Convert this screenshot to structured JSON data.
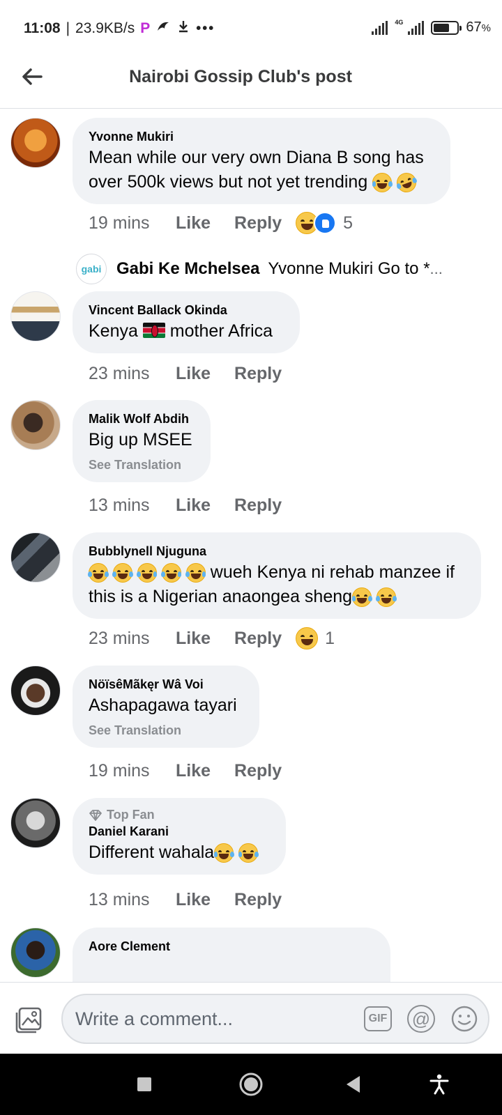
{
  "status_bar": {
    "time": "11:08",
    "speed": "23.9KB/s",
    "network": "4G",
    "battery": "67",
    "battery_unit": "%",
    "battery_level": 0.67
  },
  "header": {
    "title": "Nairobi Gossip Club's post"
  },
  "actions": {
    "like": "Like",
    "reply": "Reply"
  },
  "comments": [
    {
      "author": "Yvonne Mukiri",
      "text": "Mean while our very own Diana B song has over 500k views but not yet trending",
      "time": "19 mins",
      "reaction_count": "5",
      "reply": {
        "logo_text": "gabi",
        "author": "Gabi Ke Mchelsea",
        "text": "Yvonne Mukiri Go to *",
        "ellipsis": "..."
      }
    },
    {
      "author": "Vincent Ballack Okinda",
      "text_before": "Kenya",
      "text_after": "mother Africa",
      "time": "23 mins"
    },
    {
      "author": "Malik Wolf Abdih",
      "text": "Big up MSEE",
      "see_translation": "See Translation",
      "time": "13 mins"
    },
    {
      "author": "Bubblynell Njuguna",
      "text_1": "wueh Kenya ni rehab manzee if",
      "text_2": "this is a Nigerian anaongea sheng",
      "time": "23 mins",
      "reaction_count": "1"
    },
    {
      "author": "NöïsêMãkęr Wâ Voi",
      "text": "Ashapagawa tayari",
      "see_translation": "See Translation",
      "time": "19 mins"
    },
    {
      "badge": "Top Fan",
      "author": "Daniel Karani",
      "text": "Different wahala",
      "time": "13 mins"
    },
    {
      "author": "Aore Clement"
    }
  ],
  "composer": {
    "placeholder": "Write a comment...",
    "gif_label": "GIF",
    "at_label": "@"
  },
  "colors": {
    "accent": "#1877f2",
    "bubble": "#f0f2f5",
    "meta_text": "#65676b"
  }
}
